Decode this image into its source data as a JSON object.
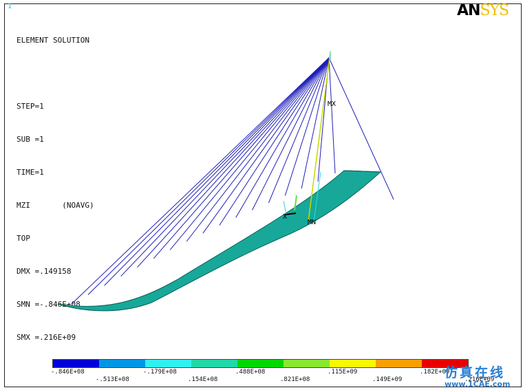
{
  "window_index": "1",
  "info_lines": [
    "ELEMENT SOLUTION",
    "",
    "STEP=1",
    "SUB =1",
    "TIME=1",
    "MZI       (NOAVG)",
    "TOP",
    "DMX =.149158",
    "SMN =-.846E+08",
    "SMX =.216E+09"
  ],
  "logo": {
    "part1": "AN",
    "part2": "SYS"
  },
  "markers": {
    "max": "MX",
    "min": "MN",
    "axis": "X"
  },
  "legend": {
    "colors": [
      "#0000d8",
      "#0096e6",
      "#33f0f0",
      "#22d8a8",
      "#00d800",
      "#8ae830",
      "#f8f800",
      "#f8a000",
      "#e80000"
    ],
    "top_labels": [
      "-.846E+08",
      "-.179E+08",
      ".488E+08",
      ".115E+09",
      ".182E+09"
    ],
    "bottom_labels": [
      "-.513E+08",
      ".154E+08",
      ".821E+08",
      ".149E+09",
      ".216E+09"
    ]
  },
  "watermark": {
    "chinese": "仿真在线",
    "url": "www.1CAE.com"
  }
}
